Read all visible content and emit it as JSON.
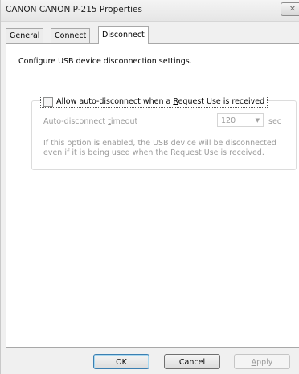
{
  "window": {
    "title": "CANON CANON P-215 Properties",
    "close_glyph": "✕"
  },
  "tabs": [
    {
      "label": "General"
    },
    {
      "label": "Connect"
    },
    {
      "label": "Disconnect"
    }
  ],
  "panel": {
    "intro": "Configure USB device disconnection settings.",
    "auto_disconnect": {
      "checkbox_label_before": "Allow auto-disconnect when a ",
      "checkbox_label_accel": "R",
      "checkbox_label_after": "equest Use is received",
      "checked": false
    },
    "timeout": {
      "label_before": "Auto-disconnect ",
      "label_accel": "t",
      "label_after": "imeout",
      "value": "120",
      "unit": "sec"
    },
    "description": "If this option is enabled, the USB device will be disconnected even if it is being used when the Request Use is received."
  },
  "buttons": {
    "ok": "OK",
    "cancel": "Cancel",
    "apply_accel": "A",
    "apply_rest": "pply"
  },
  "icons": {
    "close": "close-icon",
    "dropdown": "chevron-down-icon",
    "checkbox": "checkbox-icon"
  }
}
